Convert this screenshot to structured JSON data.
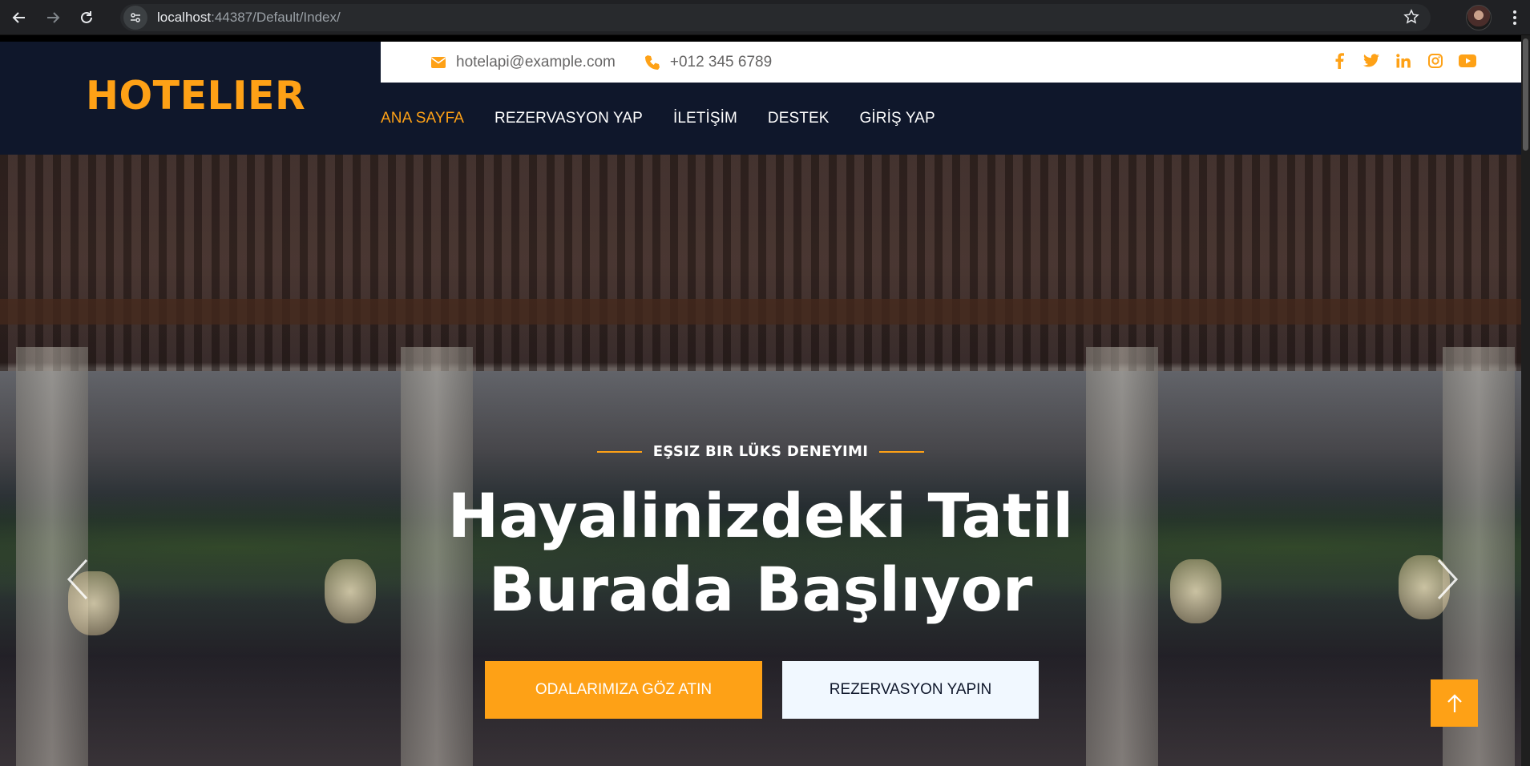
{
  "browser": {
    "url_host": "localhost",
    "url_rest": ":44387/Default/Index/"
  },
  "header": {
    "brand": "HOTELIER",
    "email": "hotelapi@example.com",
    "phone": "+012 345 6789",
    "socials": [
      "facebook-icon",
      "twitter-icon",
      "linkedin-icon",
      "instagram-icon",
      "youtube-icon"
    ],
    "nav": [
      "ANA SAYFA",
      "REZERVASYON YAP",
      "İLETİŞİM",
      "DESTEK",
      "GİRİŞ YAP"
    ]
  },
  "hero": {
    "eyebrow": "EŞSIZ BIR LÜKS DENEYIMI",
    "headline_line1": "Hayalinizdeki Tatil",
    "headline_line2": "Burada Başlıyor",
    "cta_primary": "ODALARIMIZA GÖZ ATIN",
    "cta_secondary": "REZERVASYON YAPIN"
  },
  "colors": {
    "accent": "#fea116",
    "dark": "#0f172b",
    "light_button": "#f1f8ff"
  }
}
